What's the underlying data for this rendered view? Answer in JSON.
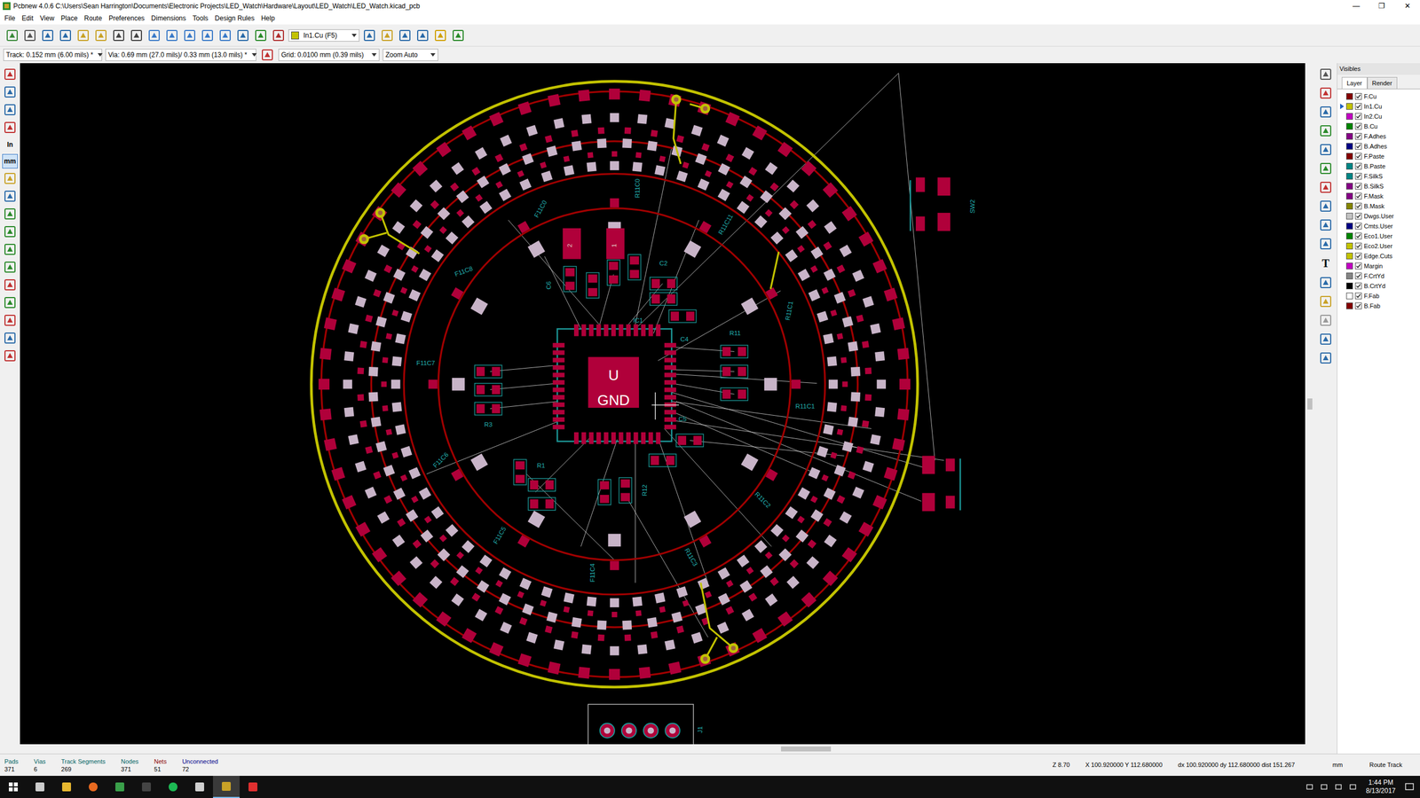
{
  "window": {
    "title": "Pcbnew 4.0.6 C:\\Users\\Sean Harrington\\Documents\\Electronic Projects\\LED_Watch\\Hardware\\Layout\\LED_Watch\\LED_Watch.kicad_pcb",
    "controls": [
      "—",
      "❐",
      "✕"
    ]
  },
  "menu": [
    "File",
    "Edit",
    "View",
    "Place",
    "Route",
    "Preferences",
    "Dimensions",
    "Tools",
    "Design Rules",
    "Help"
  ],
  "toolbar": {
    "layer_select": "In1.Cu (F5)",
    "layer_color": "#c2c200"
  },
  "options_bar": {
    "track": "Track: 0.152 mm (6.00 mils) *",
    "via": "Via: 0.69 mm (27.0 mils)/ 0.33 mm (13.0 mils) *",
    "grid": "Grid: 0.0100 mm (0.39 mils)",
    "zoom": "Zoom Auto"
  },
  "units": [
    {
      "label": "In",
      "selected": false
    },
    {
      "label": "mm",
      "selected": true
    }
  ],
  "right_toolbar_texts": [
    "T"
  ],
  "board": {
    "labels": [
      "U",
      "GND",
      "IC1",
      "C2",
      "C4",
      "C5",
      "C6",
      "R11",
      "R3",
      "R1",
      "R12",
      "R11C0",
      "F11C0",
      "F11C8",
      "F11C7",
      "F11C6",
      "F11C5",
      "F11C4",
      "R11C3",
      "R11C2",
      "R11C1",
      "R11C11",
      "R11C1",
      "SW2",
      "J1",
      "2",
      "1"
    ]
  },
  "layers_panel": {
    "title": "Visibles",
    "tabs": [
      {
        "label": "Layer",
        "selected": true
      },
      {
        "label": "Render",
        "selected": false
      }
    ],
    "layers": [
      {
        "name": "F.Cu",
        "color": "#840000",
        "checked": true,
        "active": false
      },
      {
        "name": "In1.Cu",
        "color": "#c2c200",
        "checked": true,
        "active": true
      },
      {
        "name": "In2.Cu",
        "color": "#c200c2",
        "checked": true,
        "active": false
      },
      {
        "name": "B.Cu",
        "color": "#008400",
        "checked": true,
        "active": false
      },
      {
        "name": "F.Adhes",
        "color": "#840084",
        "checked": true,
        "active": false
      },
      {
        "name": "B.Adhes",
        "color": "#000084",
        "checked": true,
        "active": false
      },
      {
        "name": "F.Paste",
        "color": "#840000",
        "checked": true,
        "active": false
      },
      {
        "name": "B.Paste",
        "color": "#008484",
        "checked": true,
        "active": false
      },
      {
        "name": "F.SilkS",
        "color": "#008484",
        "checked": true,
        "active": false
      },
      {
        "name": "B.SilkS",
        "color": "#840084",
        "checked": true,
        "active": false
      },
      {
        "name": "F.Mask",
        "color": "#840084",
        "checked": true,
        "active": false
      },
      {
        "name": "B.Mask",
        "color": "#848400",
        "checked": true,
        "active": false
      },
      {
        "name": "Dwgs.User",
        "color": "#c2c2c2",
        "checked": true,
        "active": false
      },
      {
        "name": "Cmts.User",
        "color": "#000084",
        "checked": true,
        "active": false
      },
      {
        "name": "Eco1.User",
        "color": "#008400",
        "checked": true,
        "active": false
      },
      {
        "name": "Eco2.User",
        "color": "#c2c200",
        "checked": true,
        "active": false
      },
      {
        "name": "Edge.Cuts",
        "color": "#c2c200",
        "checked": true,
        "active": false
      },
      {
        "name": "Margin",
        "color": "#c200c2",
        "checked": true,
        "active": false
      },
      {
        "name": "F.CrtYd",
        "color": "#848484",
        "checked": true,
        "active": false
      },
      {
        "name": "B.CrtYd",
        "color": "#000000",
        "checked": true,
        "active": false
      },
      {
        "name": "F.Fab",
        "color": "#ffffff",
        "checked": true,
        "active": false
      },
      {
        "name": "B.Fab",
        "color": "#840000",
        "checked": true,
        "active": false
      }
    ]
  },
  "status": {
    "counts": [
      {
        "label": "Pads",
        "value": "371",
        "color": "#006464"
      },
      {
        "label": "Vias",
        "value": "6",
        "color": "#006464"
      },
      {
        "label": "Track Segments",
        "value": "269",
        "color": "#006464"
      },
      {
        "label": "Nodes",
        "value": "371",
        "color": "#006464"
      },
      {
        "label": "Nets",
        "value": "51",
        "color": "#8b0000"
      },
      {
        "label": "Unconnected",
        "value": "72",
        "color": "#00008b"
      }
    ],
    "zoom": "Z 8.70",
    "position": "X 100.920000 Y 112.680000",
    "delta": "dx 100.920000 dy 112.680000 dist 151.267",
    "units": "mm",
    "mode": "Route Track"
  },
  "taskbar": {
    "time": "1:44 PM",
    "date": "8/13/2017"
  }
}
